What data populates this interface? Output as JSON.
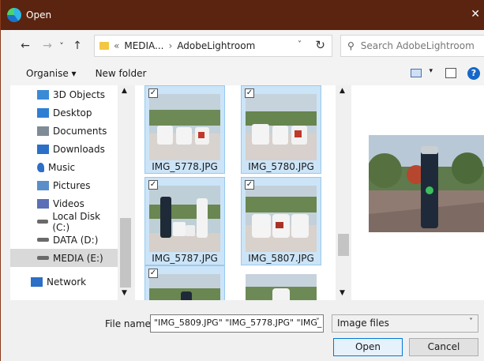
{
  "window": {
    "title": "Open",
    "close_glyph": "✕"
  },
  "address": {
    "back": "←",
    "forward": "→",
    "recent": "˅",
    "up": "↑",
    "crumb_sep": "«",
    "crumbs": [
      "MEDIA...",
      "AdobeLightroom"
    ],
    "path_sep": "›",
    "dropdown": "˅",
    "refresh": "↻"
  },
  "search": {
    "placeholder": "Search AdobeLightroom"
  },
  "toolbar": {
    "organise": "Organise ▾",
    "new_folder": "New folder",
    "view_dd": "▾",
    "help": "?"
  },
  "nav": {
    "items": [
      {
        "label": "3D Objects",
        "icon": "cube-icon",
        "color": "#3a8ad6"
      },
      {
        "label": "Desktop",
        "icon": "desktop-icon",
        "color": "#2d7fd3"
      },
      {
        "label": "Documents",
        "icon": "document-icon",
        "color": "#7f8b96"
      },
      {
        "label": "Downloads",
        "icon": "download-icon",
        "color": "#2b6fc7"
      },
      {
        "label": "Music",
        "icon": "music-icon",
        "color": "#2b6fc7"
      },
      {
        "label": "Pictures",
        "icon": "pictures-icon",
        "color": "#5a8ec9"
      },
      {
        "label": "Videos",
        "icon": "videos-icon",
        "color": "#5b6fb6"
      },
      {
        "label": "Local Disk (C:)",
        "icon": "drive-icon",
        "color": "#6a6a6a"
      },
      {
        "label": "DATA (D:)",
        "icon": "drive-icon",
        "color": "#6a6a6a"
      },
      {
        "label": "MEDIA (E:)",
        "icon": "drive-icon",
        "color": "#6a6a6a"
      },
      {
        "label": "Network",
        "icon": "network-icon",
        "color": "#2b6fc7"
      }
    ],
    "selected": "MEDIA (E:)",
    "scroll_up": "▲",
    "scroll_down": "▼"
  },
  "files": {
    "tiles": [
      {
        "label": "IMG_5778.JPG",
        "checked": true,
        "selected": true,
        "check": "✓"
      },
      {
        "label": "IMG_5780.JPG",
        "checked": true,
        "selected": true,
        "check": "✓"
      },
      {
        "label": "IMG_5787.JPG",
        "checked": true,
        "selected": true,
        "check": "✓"
      },
      {
        "label": "IMG_5807.JPG",
        "checked": true,
        "selected": true,
        "check": "✓"
      },
      {
        "label": "",
        "checked": true,
        "selected": true,
        "check": "✓"
      },
      {
        "label": "",
        "checked": false,
        "selected": false,
        "check": ""
      }
    ],
    "scroll_up": "▲",
    "scroll_down": "▼"
  },
  "bottom": {
    "file_name_label": "File name:",
    "file_name_value": "\"IMG_5809.JPG\" \"IMG_5778.JPG\" \"IMG_",
    "file_type": "Image files",
    "dropdown": "˅",
    "open": "Open",
    "cancel": "Cancel"
  },
  "colors": {
    "titlebar": "#5a2410",
    "selection": "#cce4f7",
    "accent": "#0078d7"
  }
}
